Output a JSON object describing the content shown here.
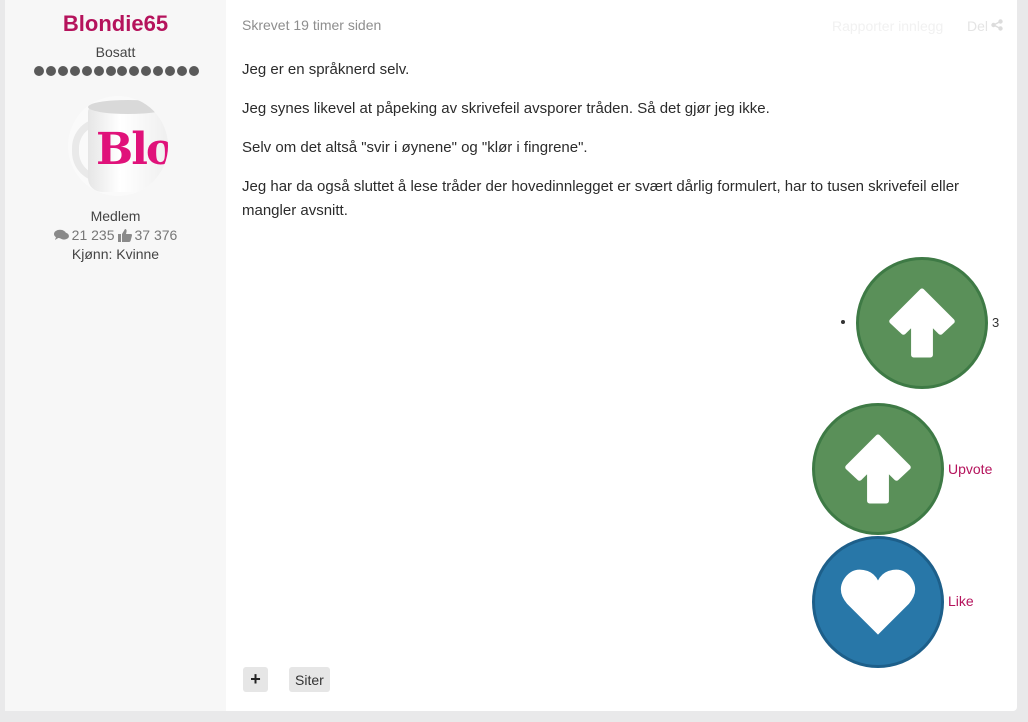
{
  "author": {
    "username": "Blondie65",
    "location": "Bosatt",
    "rank_dots": 14,
    "avatar_text": "Blo",
    "role": "Medlem",
    "posts": "21 235",
    "likes": "37 376",
    "gender": "Kjønn: Kvinne"
  },
  "post": {
    "timestamp": "Skrevet 19 timer siden",
    "report_label": "Rapporter innlegg",
    "share_label": "Del",
    "paragraphs": [
      "Jeg er en språknerd selv.",
      "Jeg synes likevel at påpeking av skrivefeil avsporer tråden. Så det gjør jeg ikke.",
      "Selv om det altså \"svir i øynene\" og \"klør i fingrene\".",
      "Jeg har da også sluttet å lese tråder der hovedinnlegget er svært dårlig formulert, har to tusen skrivefeil eller mangler avsnitt."
    ]
  },
  "reactions": {
    "upvote_count": "3",
    "upvote_label": "Upvote",
    "like_label": "Like"
  },
  "actions": {
    "plus_label": "+",
    "quote_label": "Siter"
  },
  "colors": {
    "brand": "#b5135c",
    "upvote_green": "#5a9059",
    "like_blue": "#2877a8"
  }
}
